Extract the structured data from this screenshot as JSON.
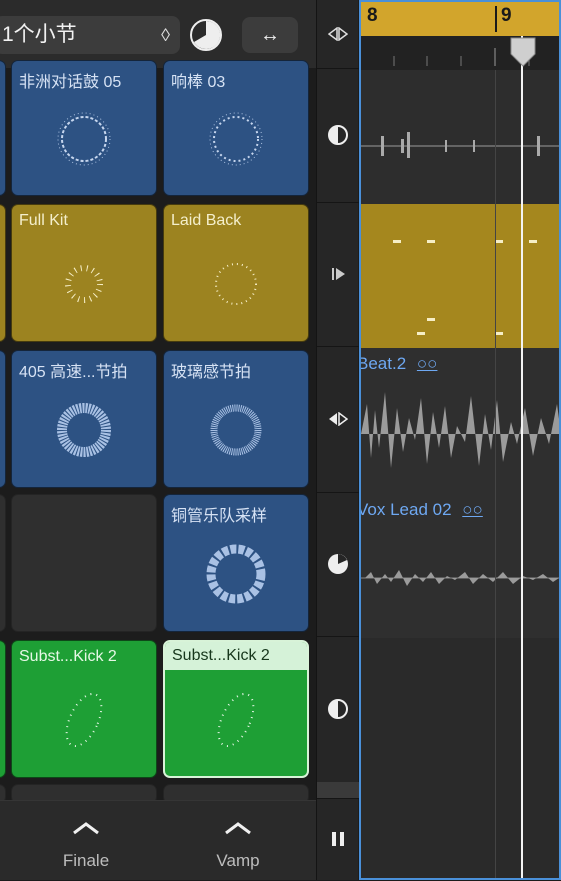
{
  "toolbar": {
    "quantize_value": "1个小节",
    "stepper_glyph": "◊",
    "expand_glyph": "↔"
  },
  "cells": [
    {
      "name": "非洲对话鼓 05",
      "color": "#2d5283"
    },
    {
      "name": "响棒 03",
      "color": "#2d5283"
    },
    {
      "name": "Full Kit",
      "color": "#9c8320"
    },
    {
      "name": "Laid Back",
      "color": "#9c8320"
    },
    {
      "name": "405 高速...节拍",
      "color": "#2d5283"
    },
    {
      "name": "玻璃感节拍",
      "color": "#2d5283"
    },
    {
      "name": "",
      "color": "#2f2f2f"
    },
    {
      "name": "铜管乐队采样",
      "color": "#2d5283"
    },
    {
      "name": "Subst...Kick 2",
      "color": "#1e9f35"
    },
    {
      "name": "Subst...Kick 2",
      "color": "#1e9f35"
    }
  ],
  "scenes": [
    {
      "label": "Finale"
    },
    {
      "label": "Vamp"
    }
  ],
  "ruler": {
    "bar_a": "8",
    "bar_b": "9",
    "color": "#d2a52c"
  },
  "regions": [
    {
      "name": ""
    },
    {
      "name": ""
    },
    {
      "name": "Beat.2"
    },
    {
      "name": "Vox Lead 02"
    }
  ],
  "accent": "#4a90d9"
}
